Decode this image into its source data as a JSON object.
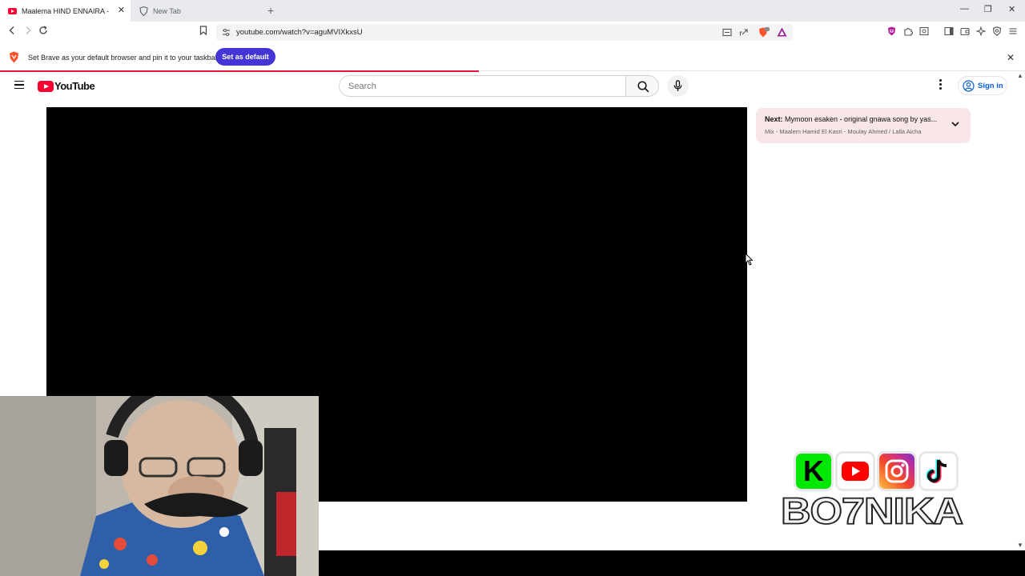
{
  "browser": {
    "tabs": [
      {
        "title": "Maalema HIND ENNAIRA - L'GNAWIYA",
        "active": true
      },
      {
        "title": "New Tab",
        "active": false
      }
    ],
    "new_tab_symbol": "+",
    "window_controls": {
      "minimize": "—",
      "restore": "❐",
      "close": "✕"
    },
    "address": "youtube.com/watch?v=aguMVIXkxsU",
    "icons": [
      "back-icon",
      "forward-icon",
      "reload-icon",
      "bookmark-icon",
      "site-info-icon",
      "cast-icon",
      "share-icon",
      "brave-shields-icon",
      "brave-rewards-icon",
      "extension-icon",
      "puzzle-icon",
      "sidebar-icon",
      "wallet-icon",
      "leo-icon",
      "vpn-icon",
      "menu-icon"
    ]
  },
  "infobar": {
    "message": "Set Brave as your default browser and pin it to your taskbar",
    "button": "Set as default",
    "close": "✕"
  },
  "youtube": {
    "logo_text": "YouTube",
    "search_placeholder": "Search",
    "signin_label": "Sign in"
  },
  "up_next": {
    "prefix": "Next:",
    "title": "Mymoon esaken - original gnawa song by yas...",
    "subtitle": "Mix - Maalem Hamid El Kasri - Moulay Ahmed / Lalla Aicha"
  },
  "overlay": {
    "brand_letter": "K",
    "brand_name": "BO7NIKA"
  },
  "colors": {
    "brave_purple": "#4436d6",
    "youtube_red": "#ff0033",
    "next_card_bg": "#f9e6e9",
    "signin_blue": "#065fd4"
  }
}
